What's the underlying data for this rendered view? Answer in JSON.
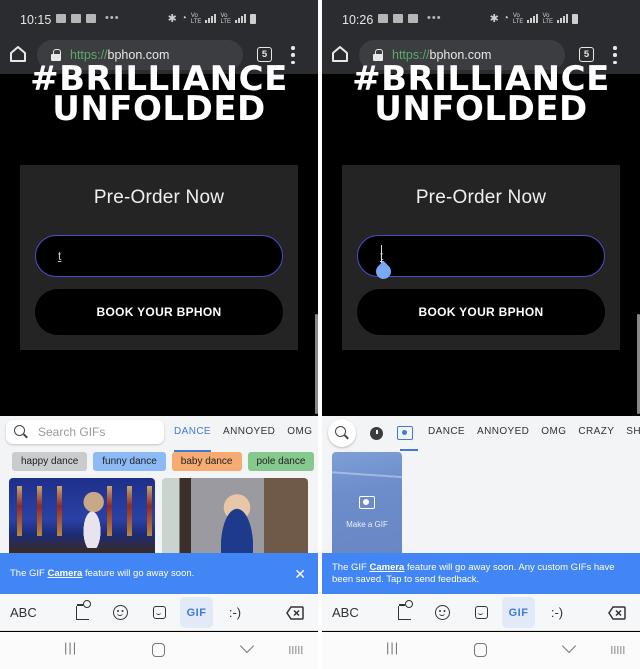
{
  "browser": {
    "url_scheme": "https://",
    "url_host": "bphon.com",
    "tab_count": "5"
  },
  "page": {
    "hero_line1": "#BRILLIANCE",
    "hero_line2": "UNFOLDED",
    "card_title": "Pre-Order Now",
    "input_value": "t",
    "book_button": "BOOK YOUR BPHON"
  },
  "screens": [
    {
      "status_time": "10:15",
      "gif": {
        "search_placeholder": "Search GIFs",
        "tabs": [
          {
            "label": "DANCE",
            "active": true
          },
          {
            "label": "ANNOYED",
            "active": false
          },
          {
            "label": "OMG",
            "active": false
          }
        ],
        "chips": [
          "happy dance",
          "funny dance",
          "baby dance",
          "pole dance"
        ],
        "chip_colors": [
          "#c9cbcd",
          "#8db9f5",
          "#f6ab72",
          "#86c98f"
        ]
      },
      "banner": {
        "prefix": "The GIF ",
        "link": "Camera",
        "suffix": " feature will go away soon."
      }
    },
    {
      "status_time": "10:26",
      "gif": {
        "tabs": [
          {
            "label": "DANCE",
            "active": false
          },
          {
            "label": "ANNOYED",
            "active": false
          },
          {
            "label": "OMG",
            "active": false
          },
          {
            "label": "CRAZY",
            "active": false
          },
          {
            "label": "SHR",
            "active": false
          }
        ],
        "make_gif_label": "Make a GIF"
      },
      "banner": {
        "prefix": "The GIF ",
        "link": "Camera",
        "suffix": " feature will go away soon. Any custom GIFs have been saved. Tap to send feedback."
      }
    }
  ],
  "keyboard": {
    "abc_label": "ABC",
    "gif_label": "GIF",
    "emoticon_label": ":-)"
  },
  "navbar": {
    "recent_label": "|||"
  },
  "colors": {
    "accent": "#3f7ad9",
    "banner": "#4285f4",
    "url_scheme": "#5fa86a",
    "input_border": "#4a4fc9"
  }
}
